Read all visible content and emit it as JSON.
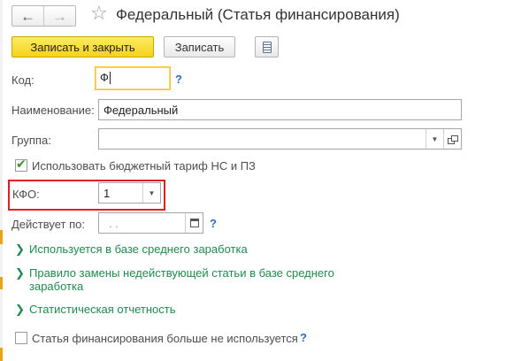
{
  "window": {
    "title": "Федеральный (Статья финансирования)",
    "back_icon": "arrow-left",
    "forward_icon": "arrow-right",
    "favorite_icon": "star-outline"
  },
  "toolbar": {
    "save_close_label": "Записать и закрыть",
    "save_label": "Записать",
    "more_icon": "document-list"
  },
  "form": {
    "code": {
      "label": "Код:",
      "value": "Ф",
      "help": "?"
    },
    "name": {
      "label": "Наименование:",
      "value": "Федеральный"
    },
    "group": {
      "label": "Группа:",
      "value": ""
    },
    "budget_tariff": {
      "label": "Использовать бюджетный тариф НС и ПЗ",
      "checked": true
    },
    "kfo": {
      "label": "КФО:",
      "value": "1"
    },
    "valid_until": {
      "label": "Действует по:",
      "value": ". .",
      "help": "?"
    },
    "sections": [
      {
        "label": "Используется в базе среднего заработка"
      },
      {
        "label_line1": "Правило замены недействующей статьи в базе среднего",
        "label_line2": "заработка"
      },
      {
        "label": "Статистическая отчетность"
      }
    ],
    "not_used": {
      "label": "Статья финансирования больше не используется",
      "checked": false,
      "help": "?"
    }
  },
  "colors": {
    "primary_button": "#f5d21a",
    "link_green": "#1f8a4d",
    "help_blue": "#2c6bc9",
    "highlight_red": "#e31b23"
  }
}
